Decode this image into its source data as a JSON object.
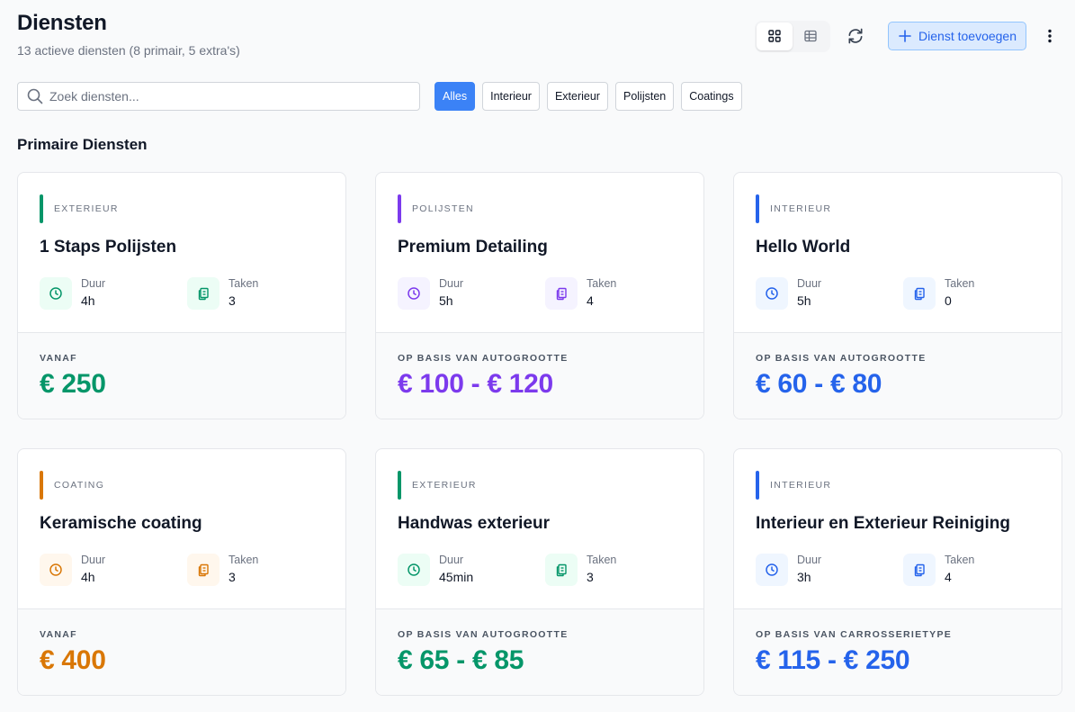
{
  "header": {
    "title": "Diensten",
    "subtitle": "13 actieve diensten (8 primair, 5 extra's)"
  },
  "toolbar": {
    "add_label": "Dienst toevoegen"
  },
  "search": {
    "placeholder": "Zoek diensten...",
    "value": ""
  },
  "filters": [
    "Alles",
    "Interieur",
    "Exterieur",
    "Polijsten",
    "Coatings"
  ],
  "active_filter": "Alles",
  "section": {
    "title": "Primaire Diensten"
  },
  "stat_labels": {
    "duration": "Duur",
    "tasks": "Taken"
  },
  "colors": {
    "exterieur": "#059669",
    "polijsten": "#7c3aed",
    "interieur": "#2563eb",
    "coating": "#d97706",
    "accent": "#3b82f6"
  },
  "services": [
    {
      "category": "EXTERIEUR",
      "name": "1 Staps Polijsten",
      "duration": "4h",
      "tasks": "3",
      "price_label": "VANAF",
      "price": "€ 250",
      "color": "#059669",
      "tint": "#ecfdf5"
    },
    {
      "category": "POLIJSTEN",
      "name": "Premium Detailing",
      "duration": "5h",
      "tasks": "4",
      "price_label": "OP BASIS VAN AUTOGROOTTE",
      "price": "€ 100 - € 120",
      "color": "#7c3aed",
      "tint": "#f5f3ff"
    },
    {
      "category": "INTERIEUR",
      "name": "Hello World",
      "duration": "5h",
      "tasks": "0",
      "price_label": "OP BASIS VAN AUTOGROOTTE",
      "price": "€ 60 - € 80",
      "color": "#2563eb",
      "tint": "#eff6ff"
    },
    {
      "category": "COATING",
      "name": "Keramische coating",
      "duration": "4h",
      "tasks": "3",
      "price_label": "VANAF",
      "price": "€ 400",
      "color": "#d97706",
      "tint": "#fff7ed"
    },
    {
      "category": "EXTERIEUR",
      "name": "Handwas exterieur",
      "duration": "45min",
      "tasks": "3",
      "price_label": "OP BASIS VAN AUTOGROOTTE",
      "price": "€ 65 - € 85",
      "color": "#059669",
      "tint": "#ecfdf5"
    },
    {
      "category": "INTERIEUR",
      "name": "Interieur en Exterieur Reiniging",
      "duration": "3h",
      "tasks": "4",
      "price_label": "OP BASIS VAN CARROSSERIETYPE",
      "price": "€ 115 - € 250",
      "color": "#2563eb",
      "tint": "#eff6ff"
    }
  ]
}
